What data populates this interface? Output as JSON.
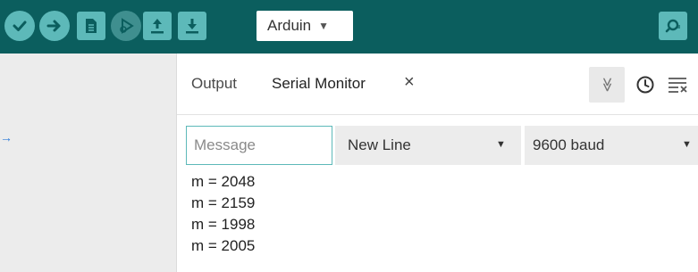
{
  "toolbar": {
    "buttons": [
      {
        "name": "verify-icon"
      },
      {
        "name": "upload-icon"
      },
      {
        "name": "new-sketch-icon"
      },
      {
        "name": "debug-icon"
      },
      {
        "name": "open-icon"
      },
      {
        "name": "save-icon"
      }
    ],
    "board_select": {
      "label": "Arduin",
      "caret": "▼"
    },
    "serial_plotter_icon": "serial-monitor-search-icon"
  },
  "sidebar": {
    "arrow": "→"
  },
  "panel": {
    "tabs": [
      {
        "label": "Output"
      },
      {
        "label": "Serial Monitor",
        "close": "×"
      }
    ],
    "actions": {
      "autoscroll": "≫",
      "timestamp_icon": "clock-icon",
      "clear_icon": "clear-output-icon"
    }
  },
  "controls": {
    "message": {
      "placeholder": "Message",
      "value": ""
    },
    "line_ending": {
      "selected": "New Line",
      "caret": "▼"
    },
    "baud_rate": {
      "selected": "9600 baud",
      "caret": "▼"
    }
  },
  "serial_output": {
    "lines": [
      "m = 2048",
      "m = 2159",
      "m = 1998",
      "m = 2005"
    ]
  },
  "colors": {
    "toolbar_bg": "#0b5e5e",
    "button_bg": "#5db9b9",
    "accent": "#5db9b9"
  }
}
